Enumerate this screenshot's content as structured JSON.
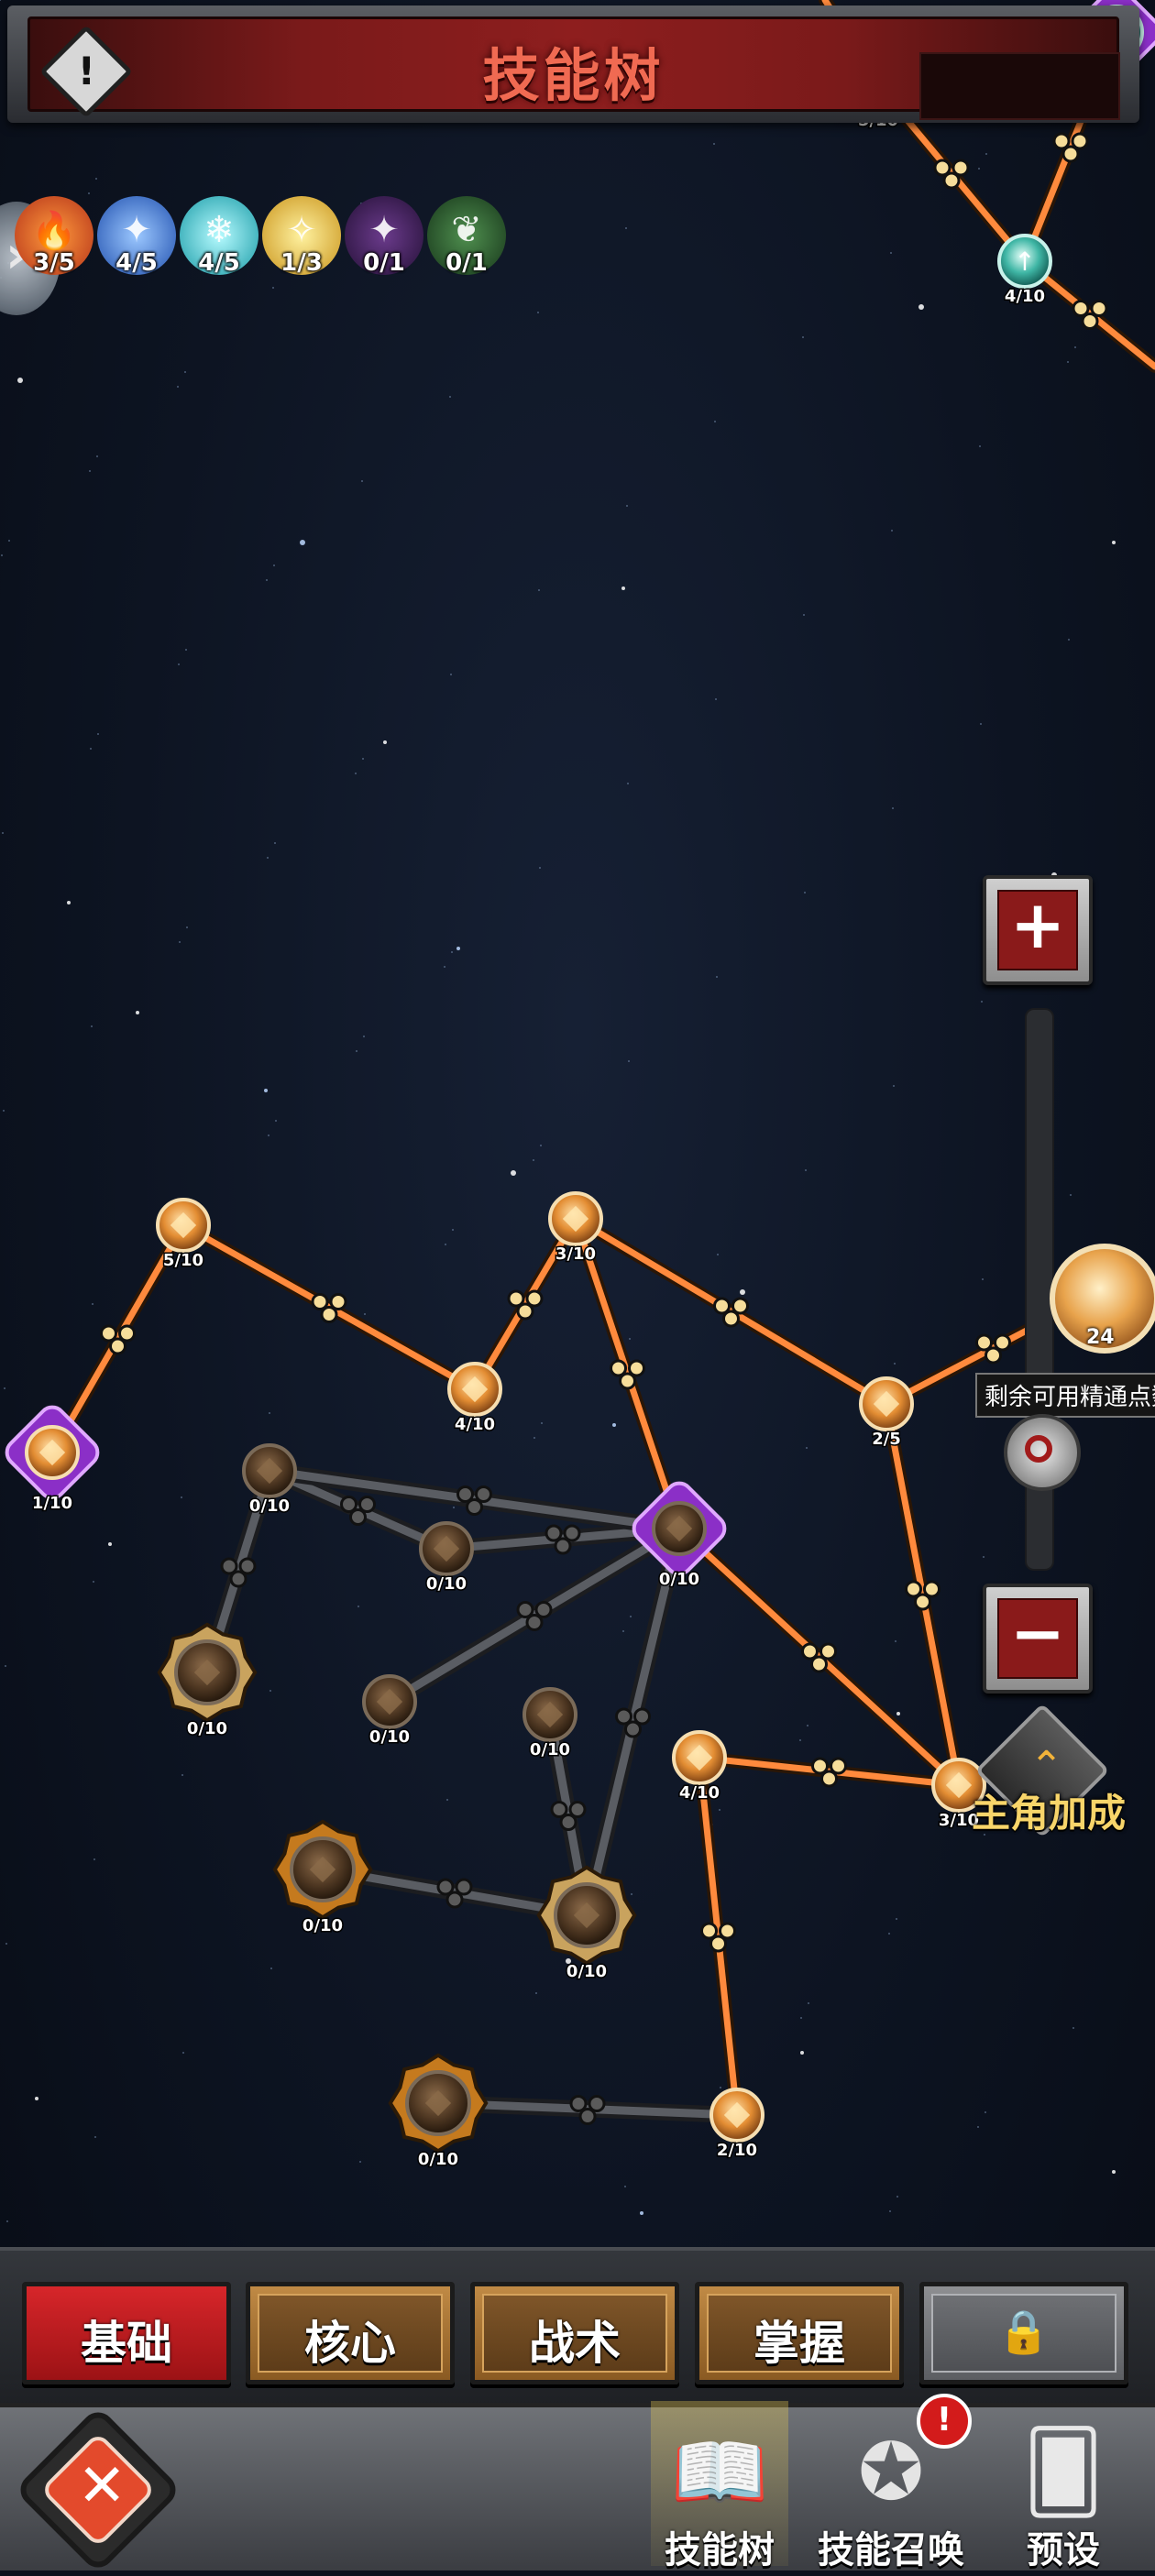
{
  "header": {
    "title": "技能树",
    "info_symbol": "!"
  },
  "elements": [
    {
      "icon": "fire-element-icon",
      "count": "3/5",
      "color": "#e9612a"
    },
    {
      "icon": "ice-shard-element-icon",
      "count": "4/5",
      "color": "#2c6fd9"
    },
    {
      "icon": "snowflake-element-icon",
      "count": "4/5",
      "color": "#2ad0d6"
    },
    {
      "icon": "light-element-icon",
      "count": "1/3",
      "color": "#e8c12a"
    },
    {
      "icon": "dark-element-icon",
      "count": "0/1",
      "color": "#5b2d7a"
    },
    {
      "icon": "nature-element-icon",
      "count": "0/1",
      "color": "#2f6d33"
    }
  ],
  "top_nodes": [
    {
      "label": "5/10"
    },
    {
      "label": "4/10"
    },
    {
      "label": "1/10"
    }
  ],
  "tree_nodes": [
    {
      "id": "n1",
      "label": "5/10",
      "state": "on"
    },
    {
      "id": "n2",
      "label": "1/10",
      "state": "on"
    },
    {
      "id": "n3",
      "label": "4/10",
      "state": "on"
    },
    {
      "id": "n4",
      "label": "3/10",
      "state": "on"
    },
    {
      "id": "n5",
      "label": "2/5",
      "state": "on"
    },
    {
      "id": "n6",
      "label": "0/10",
      "state": "off"
    },
    {
      "id": "n7",
      "label": "0/10",
      "state": "off"
    },
    {
      "id": "n8",
      "label": "0/10",
      "state": "off"
    },
    {
      "id": "n9",
      "label": "0/10",
      "state": "off"
    },
    {
      "id": "n10",
      "label": "0/10",
      "state": "off"
    },
    {
      "id": "n11",
      "label": "0/10",
      "state": "off"
    },
    {
      "id": "n12",
      "label": "4/10",
      "state": "on"
    },
    {
      "id": "n13",
      "label": "3/10",
      "state": "on"
    },
    {
      "id": "n14",
      "label": "0/10",
      "state": "off"
    },
    {
      "id": "n15",
      "label": "0/10",
      "state": "off"
    },
    {
      "id": "n16",
      "label": "0/10",
      "state": "off"
    },
    {
      "id": "n17",
      "label": "2/10",
      "state": "on"
    }
  ],
  "controls": {
    "zoom_in": "+",
    "zoom_out": "−",
    "remaining_label": "剩余可用精通点数",
    "hero_level": "24",
    "bonus_label": "主角加成"
  },
  "tabs": [
    {
      "label": "基础",
      "active": true
    },
    {
      "label": "核心",
      "active": false
    },
    {
      "label": "战术",
      "active": false
    },
    {
      "label": "掌握",
      "active": false
    },
    {
      "label": "",
      "locked": true,
      "icon": "lock-icon"
    }
  ],
  "bottom_nav": [
    {
      "label": "技能树",
      "icon": "book-icon",
      "selected": true
    },
    {
      "label": "技能召唤",
      "icon": "pentagram-icon",
      "badge": "!"
    },
    {
      "label": "预设",
      "icon": "cards-icon"
    }
  ],
  "colors": {
    "active_link": "#ff8a3d",
    "inactive_link": "#5a5d63",
    "title_red": "#f06a52",
    "active_tab": "#d7262a"
  }
}
